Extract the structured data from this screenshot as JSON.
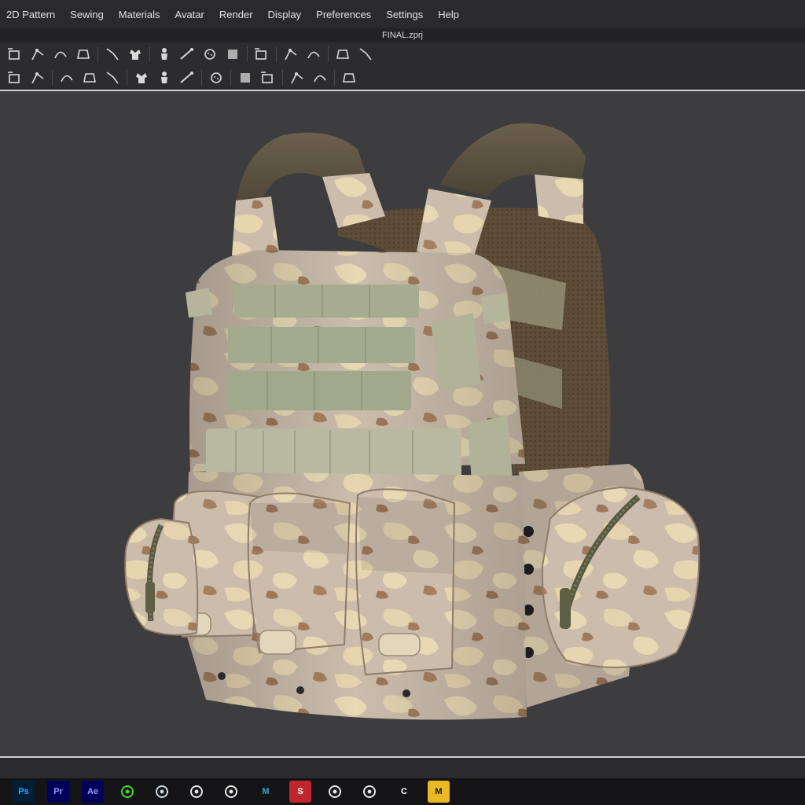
{
  "menu": [
    "2D Pattern",
    "Sewing",
    "Materials",
    "Avatar",
    "Render",
    "Display",
    "Preferences",
    "Settings",
    "Help"
  ],
  "window": {
    "title": "FINAL.zprj"
  },
  "toolbar_row1": [
    "transform-pattern-icon",
    "edit-pattern-icon",
    "edit-curvature-icon",
    "add-point-icon",
    "separator",
    "internal-line-icon",
    "trace-icon",
    "separator",
    "flatten-icon",
    "tshirt-tool-icon",
    "shirt-back-tool-icon",
    "avatar-figure-icon",
    "separator",
    "shrinkage-icon",
    "separator",
    "measure-line-icon",
    "pin-icon",
    "separator",
    "fold-shirt-icon",
    "fold-shirt-alt-icon"
  ],
  "toolbar_row2": [
    "segment-sewing-icon",
    "free-sewing-icon",
    "separator",
    "mirror-sewing-icon",
    "check-sewing-icon",
    "stitch-icon",
    "separator",
    "button-icon",
    "buttonhole-icon",
    "zipper-icon",
    "separator",
    "topstitch-icon",
    "separator",
    "texture-icon",
    "graphic-icon",
    "separator",
    "puckering-icon",
    "fold-icon",
    "separator",
    "align-icon"
  ],
  "taskbar": {
    "apps": [
      {
        "name": "Photoshop",
        "label": "Ps",
        "color": "#31a8ff",
        "bg": "#001e36"
      },
      {
        "name": "Premiere Pro",
        "label": "Pr",
        "color": "#9999ff",
        "bg": "#00005b"
      },
      {
        "name": "After Effects",
        "label": "Ae",
        "color": "#9999ff",
        "bg": "#00005b"
      },
      {
        "name": "Razer",
        "label": "",
        "color": "#44d62c",
        "bg": "transparent"
      },
      {
        "name": "Steam",
        "label": "",
        "color": "#c7d5e0",
        "bg": "transparent"
      },
      {
        "name": "Marvelous Designer",
        "label": "",
        "color": "#e6e6e6",
        "bg": "transparent"
      },
      {
        "name": "ZBrush",
        "label": "",
        "color": "#e6e6e6",
        "bg": "transparent"
      },
      {
        "name": "Maya",
        "label": "M",
        "color": "#37a5cc",
        "bg": "transparent"
      },
      {
        "name": "Substance Painter",
        "label": "S",
        "color": "#ffffff",
        "bg": "#c0262e"
      },
      {
        "name": "ZBrush 2",
        "label": "",
        "color": "#e6e6e6",
        "bg": "transparent"
      },
      {
        "name": "Recorder",
        "label": "",
        "color": "#e6e6e6",
        "bg": "transparent"
      },
      {
        "name": "CLO",
        "label": "C",
        "color": "#ffffff",
        "bg": "transparent",
        "active": true
      },
      {
        "name": "Marmoset",
        "label": "M",
        "color": "#1a1a1a",
        "bg": "#e9b824"
      }
    ]
  },
  "colors": {
    "viewport_bg": "#3d3d40",
    "camo_base": "#c9b9a6",
    "camo_light": "#e6d7b4",
    "camo_brown": "#9a7455",
    "velcro_green": "#9fa58a",
    "strap_brown": "#5f5545",
    "mesh_brown": "#5a4a35"
  }
}
